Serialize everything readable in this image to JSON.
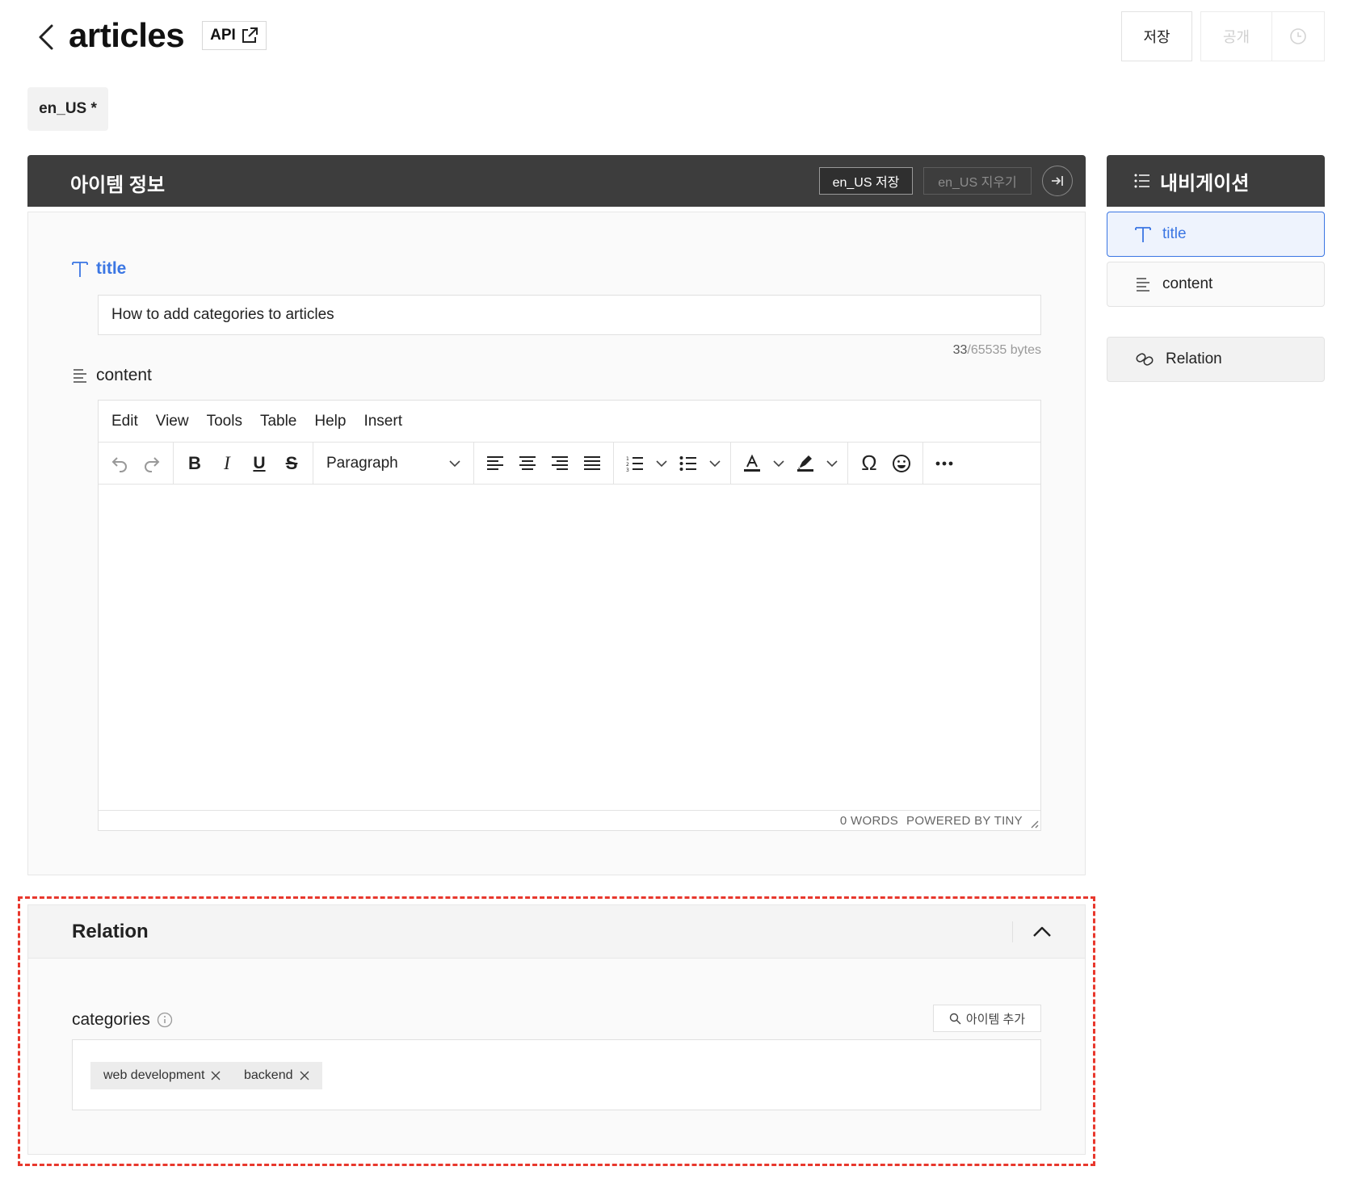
{
  "header": {
    "title": "articles",
    "api_label": "API",
    "save_label": "저장",
    "publish_label": "공개"
  },
  "locale": {
    "chip_label": "en_US *"
  },
  "item_panel": {
    "title": "아이템 정보",
    "save_locale_label": "en_US 저장",
    "clear_locale_label": "en_US  지우기"
  },
  "fields": {
    "title": {
      "label": "title",
      "value": "How to add categories to articles",
      "bytes_used": "33",
      "bytes_limit": "/65535 bytes"
    },
    "content": {
      "label": "content",
      "menu": [
        "Edit",
        "View",
        "Tools",
        "Table",
        "Help",
        "Insert"
      ],
      "block_format": "Paragraph",
      "word_count": "0 WORDS",
      "powered_by": "POWERED BY TINY"
    }
  },
  "relation": {
    "title": "Relation",
    "field_label": "categories",
    "add_item_label": "아이템 추가",
    "tags": [
      "web development",
      "backend"
    ]
  },
  "navigation": {
    "title": "내비게이션",
    "items": [
      {
        "label": "title",
        "icon": "text-type-icon",
        "active": true
      },
      {
        "label": "content",
        "icon": "paragraph-lines-icon",
        "active": false
      },
      {
        "label": "Relation",
        "icon": "link-icon",
        "active": false
      }
    ]
  },
  "colors": {
    "accent": "#3b76e3",
    "dark_bar": "#3d3d3d",
    "highlight_border": "#e8382d"
  }
}
